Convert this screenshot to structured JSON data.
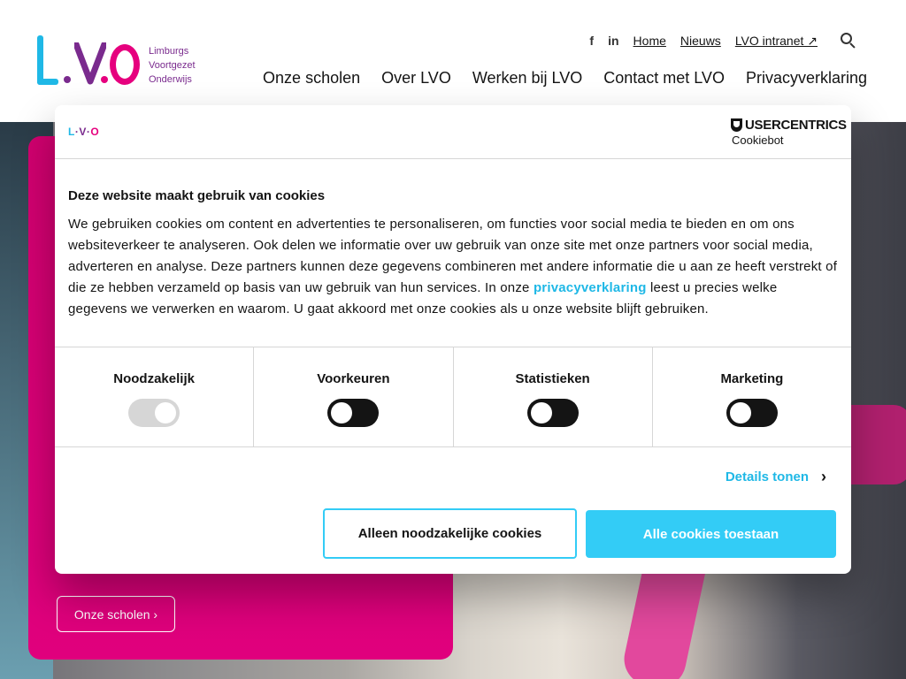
{
  "header": {
    "logo_text": [
      "Limburgs",
      "Voortgezet",
      "Onderwijs"
    ],
    "util_links": [
      {
        "label": "Home"
      },
      {
        "label": "Nieuws"
      },
      {
        "label": "LVO intranet ↗"
      }
    ],
    "social_icons": [
      "facebook-icon",
      "linkedin-icon"
    ],
    "main_nav": [
      "Onze scholen",
      "Over LVO",
      "Werken bij LVO",
      "Contact met LVO",
      "Privacyverklaring"
    ]
  },
  "hero": {
    "button_label": "Onze scholen ›"
  },
  "cookie_dialog": {
    "brand_title": "USERCENTRICS",
    "brand_sub": "Cookiebot",
    "title": "Deze website maakt gebruik van cookies",
    "text_before_link": "We gebruiken cookies om content en advertenties te personaliseren, om functies voor social media te bieden en om ons websiteverkeer te analyseren. Ook delen we informatie over uw gebruik van onze site met onze partners voor social media, adverteren en analyse. Deze partners kunnen deze gegevens combineren met andere informatie die u aan ze heeft verstrekt of die ze hebben verzameld op basis van uw gebruik van hun services. In onze ",
    "link_text": "privacyverklaring",
    "text_after_link": " leest u precies welke gegevens we verwerken en waarom. U gaat akkoord met onze cookies als u onze website blijft gebruiken.",
    "categories": [
      {
        "label": "Noodzakelijk",
        "state": "on-disabled"
      },
      {
        "label": "Voorkeuren",
        "state": "off"
      },
      {
        "label": "Statistieken",
        "state": "off"
      },
      {
        "label": "Marketing",
        "state": "off"
      }
    ],
    "details_label": "Details tonen",
    "btn_necessary": "Alleen noodzakelijke cookies",
    "btn_all": "Alle cookies toestaan"
  },
  "colors": {
    "accent_blue": "#33ccf6",
    "brand_magenta": "#e6007e",
    "brand_purple": "#7a2b8e",
    "brand_cyan": "#1fb8e6"
  }
}
